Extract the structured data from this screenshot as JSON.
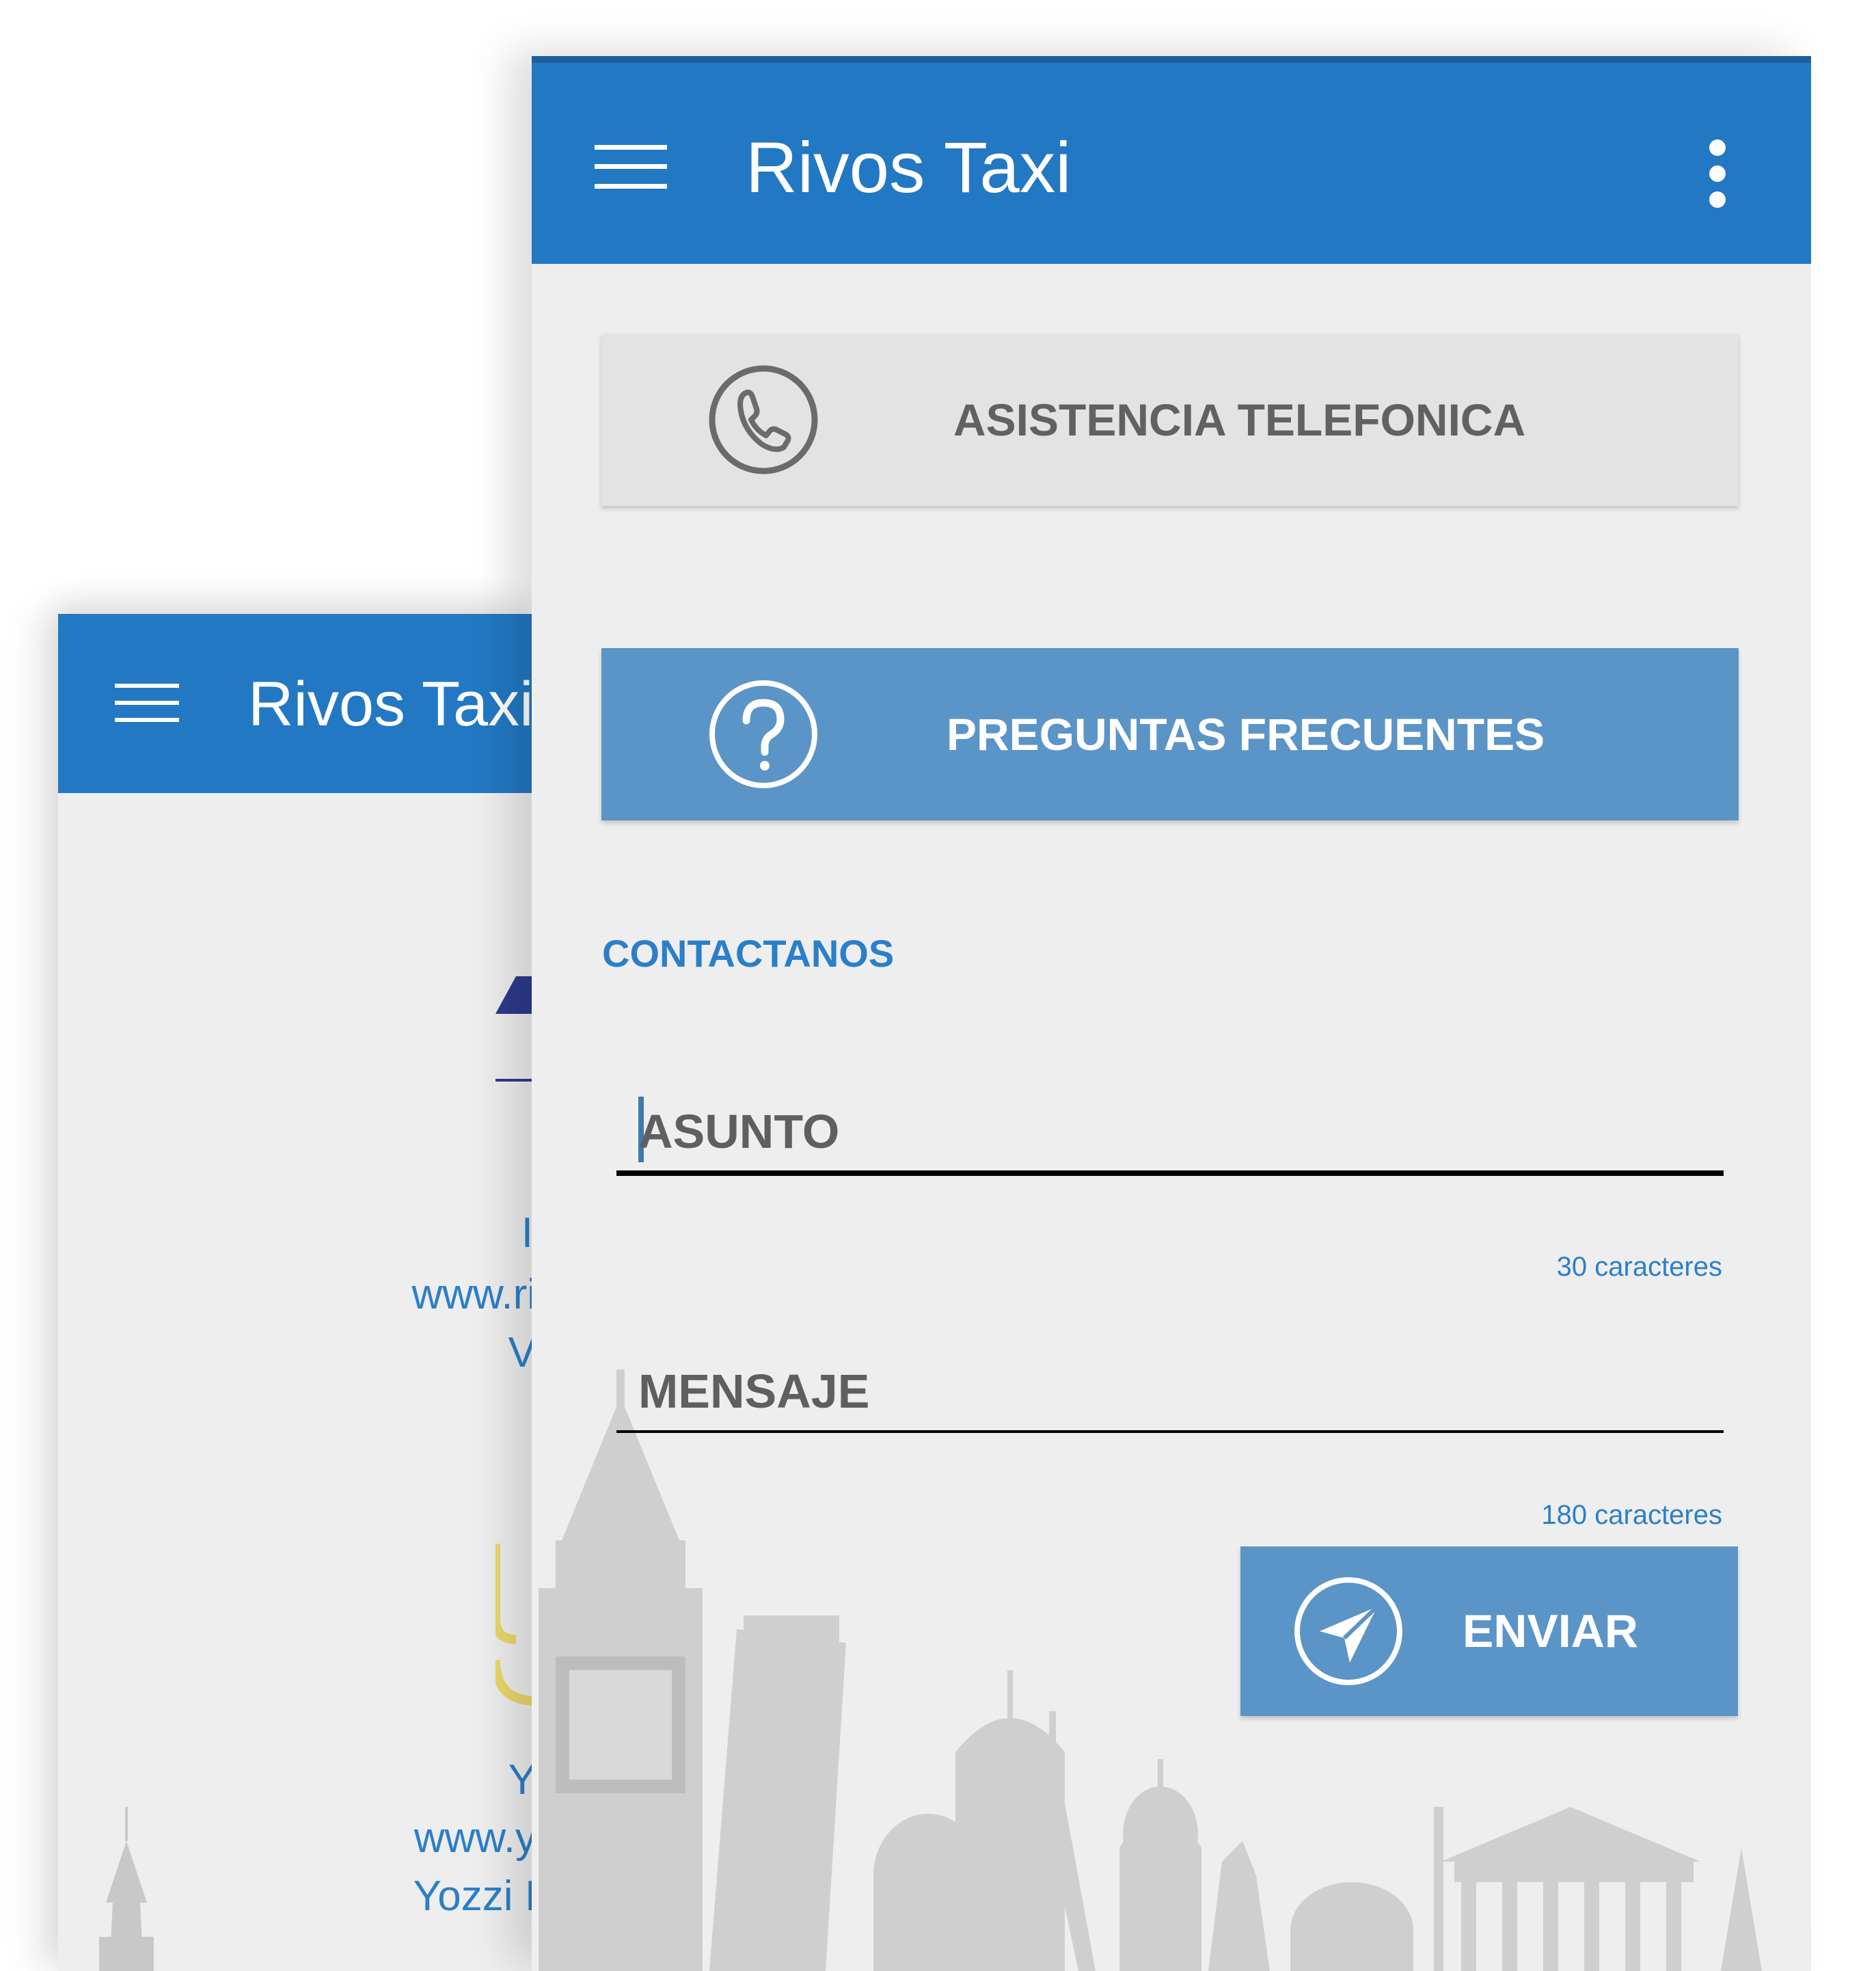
{
  "app": {
    "title": "Rivos Taxi"
  },
  "back_screen": {
    "title": "Rivos Taxi",
    "text_fragments": [
      "I",
      "www.ri",
      "V",
      "Y",
      "www.y",
      "Yozzi I"
    ]
  },
  "help": {
    "phone_button_label": "ASISTENCIA TELEFONICA",
    "faq_button_label": "PREGUNTAS FRECUENTES"
  },
  "contact": {
    "section_title": "CONTACTANOS",
    "subject_placeholder": "ASUNTO",
    "subject_counter": "30 caracteres",
    "message_placeholder": "MENSAJE",
    "message_counter": "180 caracteres",
    "send_label": "ENVIAR"
  },
  "colors": {
    "primary": "#2278c2",
    "accent_button": "#5b94c6",
    "link_text": "#2b7fc9",
    "screen_background": "#eeeeee"
  },
  "icons": {
    "menu": "menu-icon",
    "overflow": "more-vert-icon",
    "phone": "phone-icon",
    "faq": "help-circle-icon",
    "send": "send-icon"
  }
}
